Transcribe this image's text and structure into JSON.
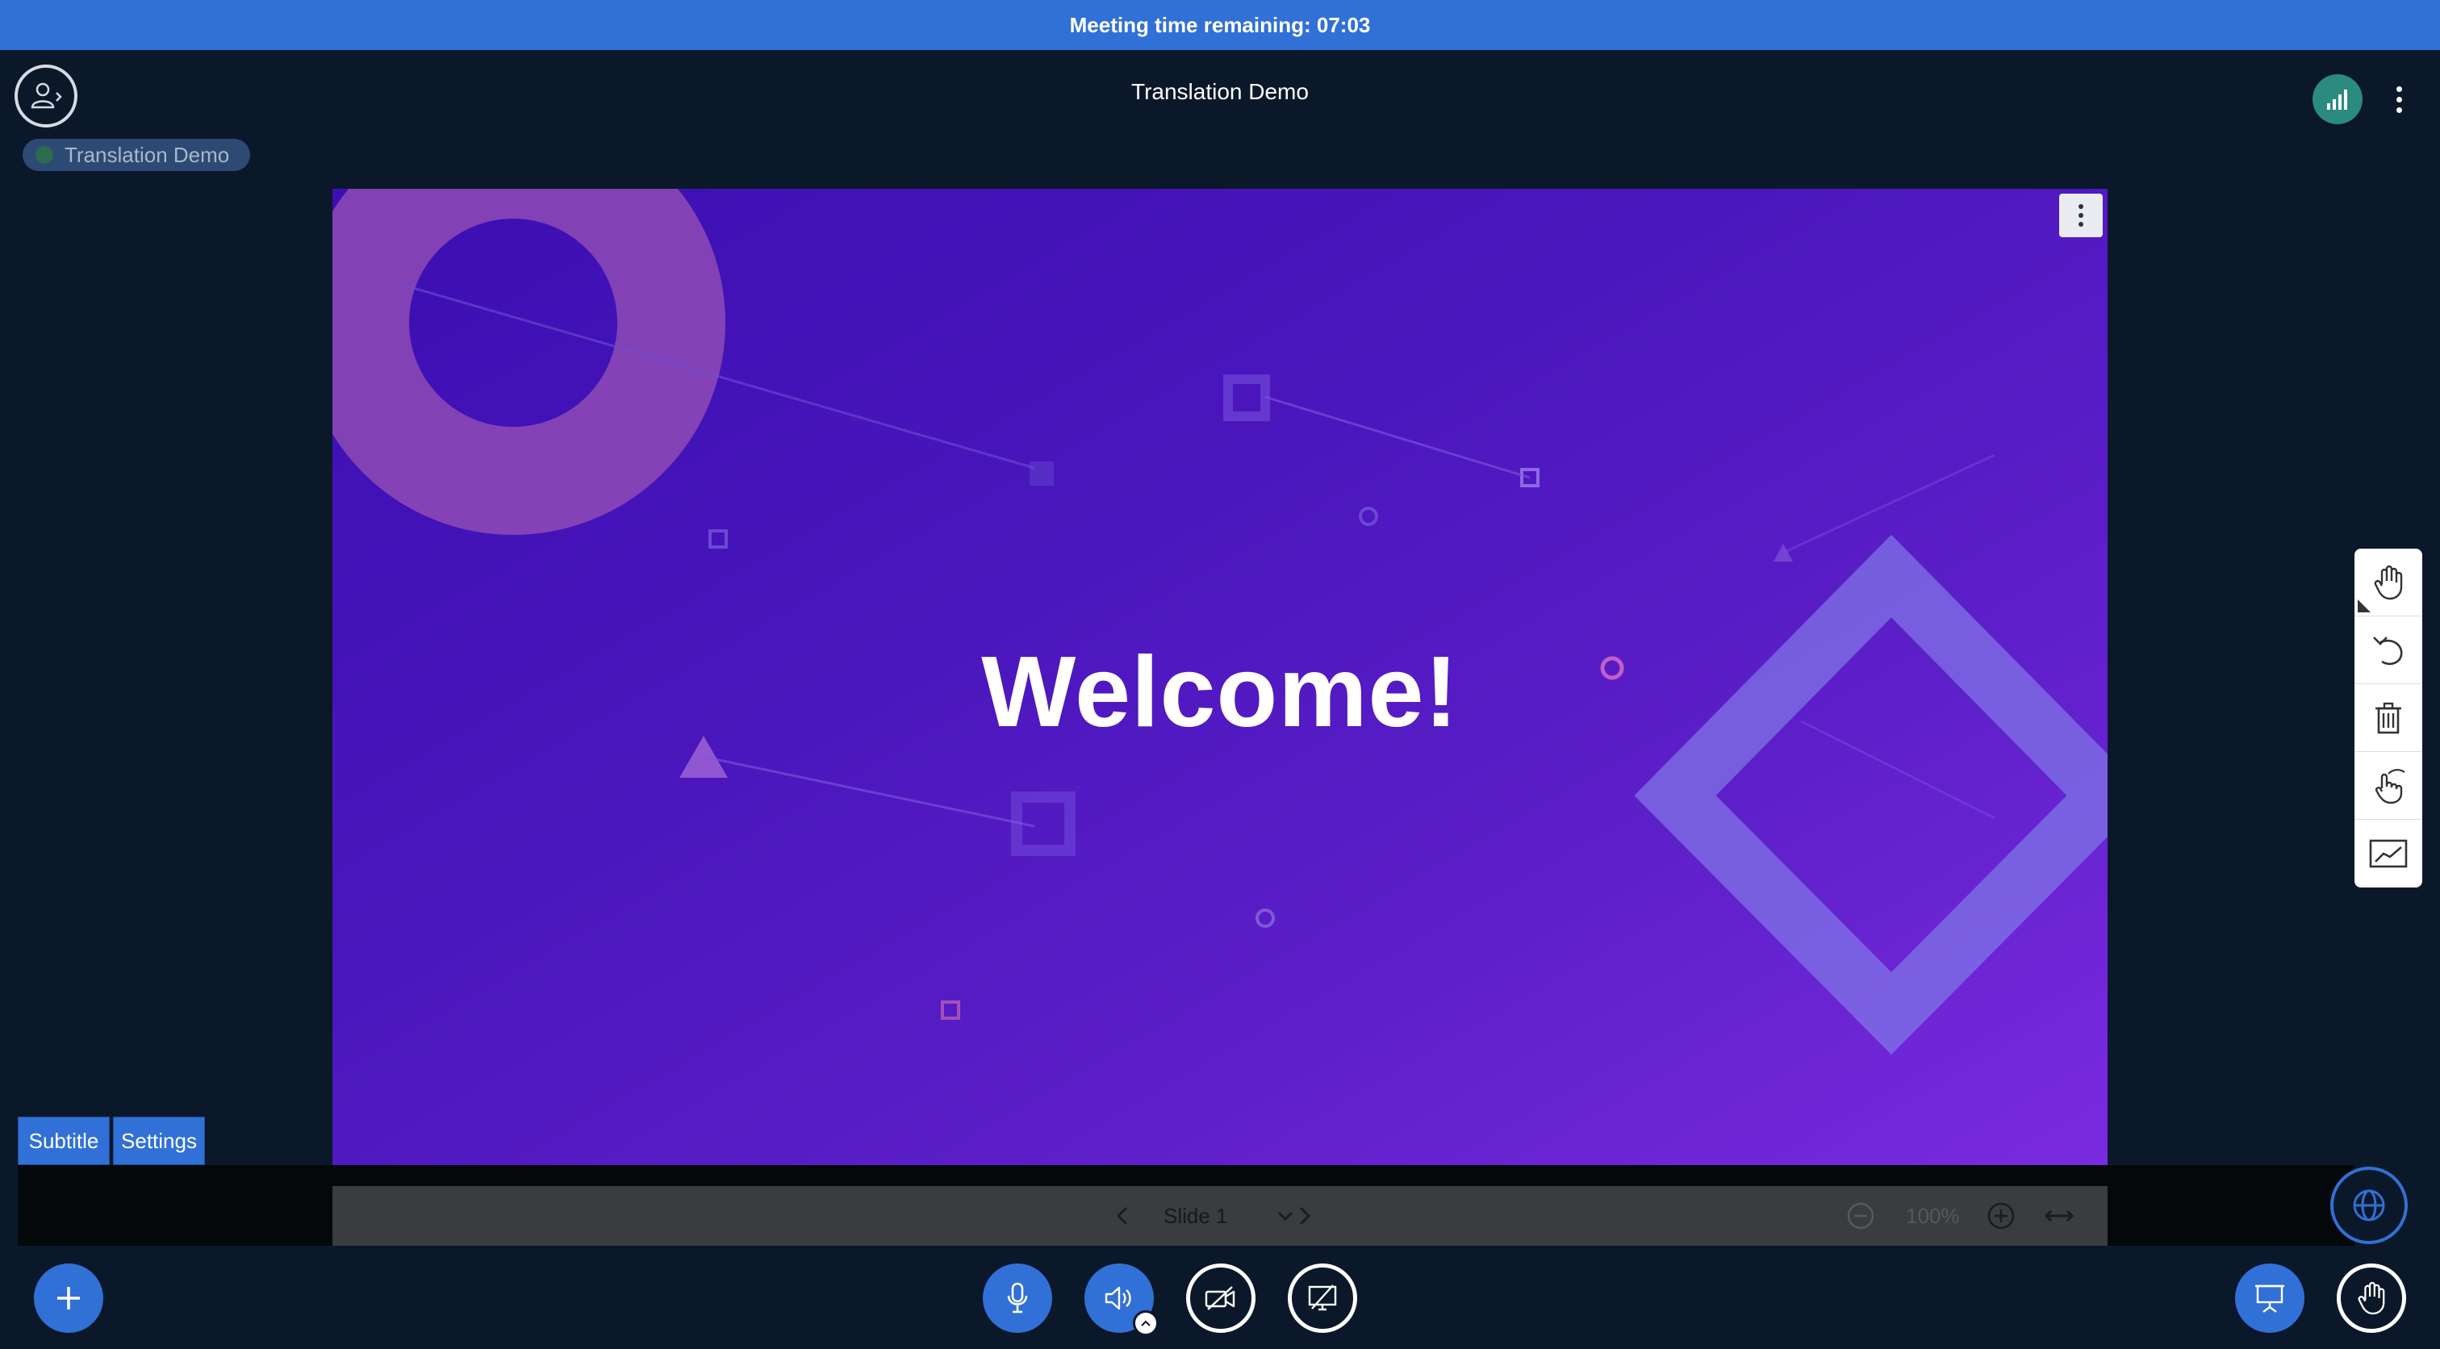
{
  "banner": {
    "text": "Meeting time remaining: 07:03"
  },
  "header": {
    "title": "Translation Demo",
    "breakout_label": "Translation Demo"
  },
  "slide": {
    "title": "Welcome!"
  },
  "subtitle_panel": {
    "subtitle_label": "Subtitle",
    "settings_label": "Settings"
  },
  "presentation_toolbar": {
    "slide_label": "Slide 1",
    "zoom_value": "100%"
  },
  "colors": {
    "banner": "#3170d6",
    "background": "#0b1829",
    "accent": "#3170d6",
    "slide_gradient_start": "#3b0fb2",
    "slide_gradient_end": "#7a2ae0"
  },
  "icons": {
    "user_list": "user-list-icon",
    "connection": "signal-bars-icon",
    "options": "kebab-icon",
    "actions": "plus-icon",
    "mic": "microphone-icon",
    "audio": "speaker-icon",
    "camera": "camera-off-icon",
    "screenshare": "screenshare-off-icon",
    "presentation": "presentation-icon",
    "raise_hand": "hand-icon",
    "language": "globe-icon"
  }
}
